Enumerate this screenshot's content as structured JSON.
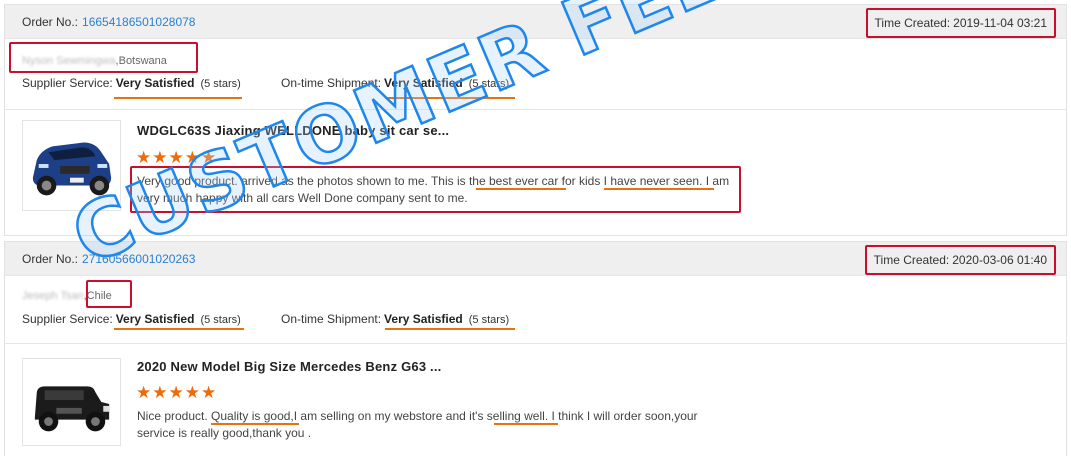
{
  "watermark": "CUSTOMER FEEDBACKS",
  "orders": [
    {
      "order_no_label": "Order No.:",
      "order_no": "16654186501028078",
      "time_label": "Time Created:",
      "time": "2019-11-04 03:21",
      "buyer_name": "Nyson Sewmingwa",
      "buyer_country": ",Botswana",
      "supplier_label": "Supplier Service:",
      "supplier_level": "Very Satisfied",
      "supplier_stars": "(5 stars)",
      "shipment_label": "On-time Shipment:",
      "shipment_level": "Very Satisfied",
      "shipment_stars": "(5 stars)",
      "product_title": "WDGLC63S Jiaxing WELLDONE baby sit car se...",
      "rating_stars": "★★★★★",
      "review": "Very good product. arrived as the photos shown to me. This is the best ever car for kids I have never seen. I am very much happy with all cars Well Done company sent to me."
    },
    {
      "order_no_label": "Order No.:",
      "order_no": "27160566001020263",
      "time_label": "Time Created:",
      "time": "2020-03-06 01:40",
      "buyer_name": "Jeseph Tsan",
      "buyer_country": ",Chile",
      "supplier_label": "Supplier Service:",
      "supplier_level": "Very Satisfied",
      "supplier_stars": "(5 stars)",
      "shipment_label": "On-time Shipment:",
      "shipment_level": "Very Satisfied",
      "shipment_stars": "(5 stars)",
      "product_title": "2020 New Model Big Size Mercedes Benz G63 ...",
      "rating_stars": "★★★★★",
      "review": "Nice product. Quality is good,I am selling on my webstore and it's selling well. I think I will order soon,your service is really good,thank you ."
    }
  ],
  "colors": {
    "link": "#2a7fd4",
    "highlight_box": "#c8102e",
    "underline": "#e6730f",
    "star": "#ee6b0a",
    "watermark": "#1f87ea"
  }
}
